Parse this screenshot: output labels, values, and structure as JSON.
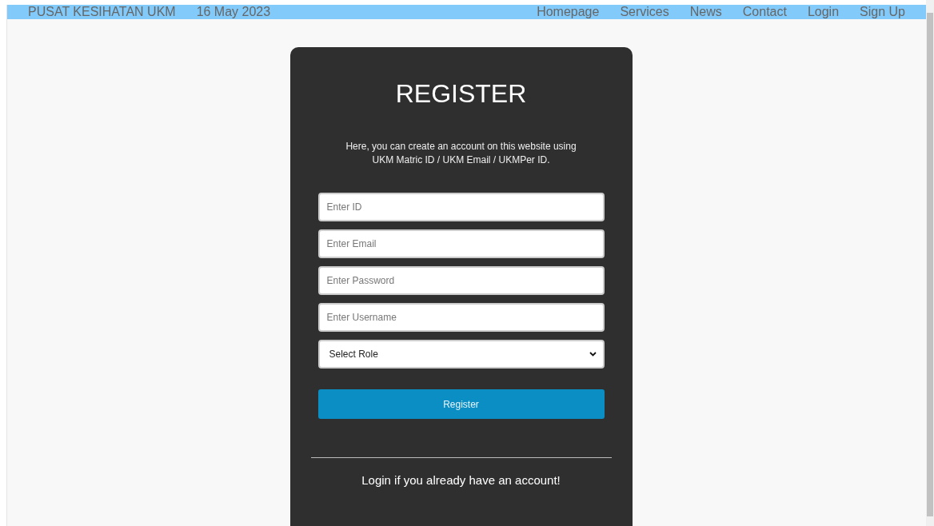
{
  "navbar": {
    "brand": "PUSAT KESIHATAN UKM",
    "date": "16 May 2023",
    "links": [
      "Homepage",
      "Services",
      "News",
      "Contact",
      "Login",
      "Sign Up"
    ]
  },
  "register_card": {
    "title": "REGISTER",
    "description": [
      "Here, you can create an account on this website using",
      "UKM Matric ID / UKM Email / UKMPer ID."
    ],
    "fields": [
      {
        "kind": "input",
        "placeholder": "Enter ID"
      },
      {
        "kind": "input",
        "placeholder": "Enter Email"
      },
      {
        "kind": "input",
        "placeholder": "Enter Password"
      },
      {
        "kind": "input",
        "placeholder": "Enter Username"
      },
      {
        "kind": "select",
        "value": "Select Role"
      }
    ],
    "submit_button": "Register",
    "login_prompt": "Login if you already have an account!"
  }
}
